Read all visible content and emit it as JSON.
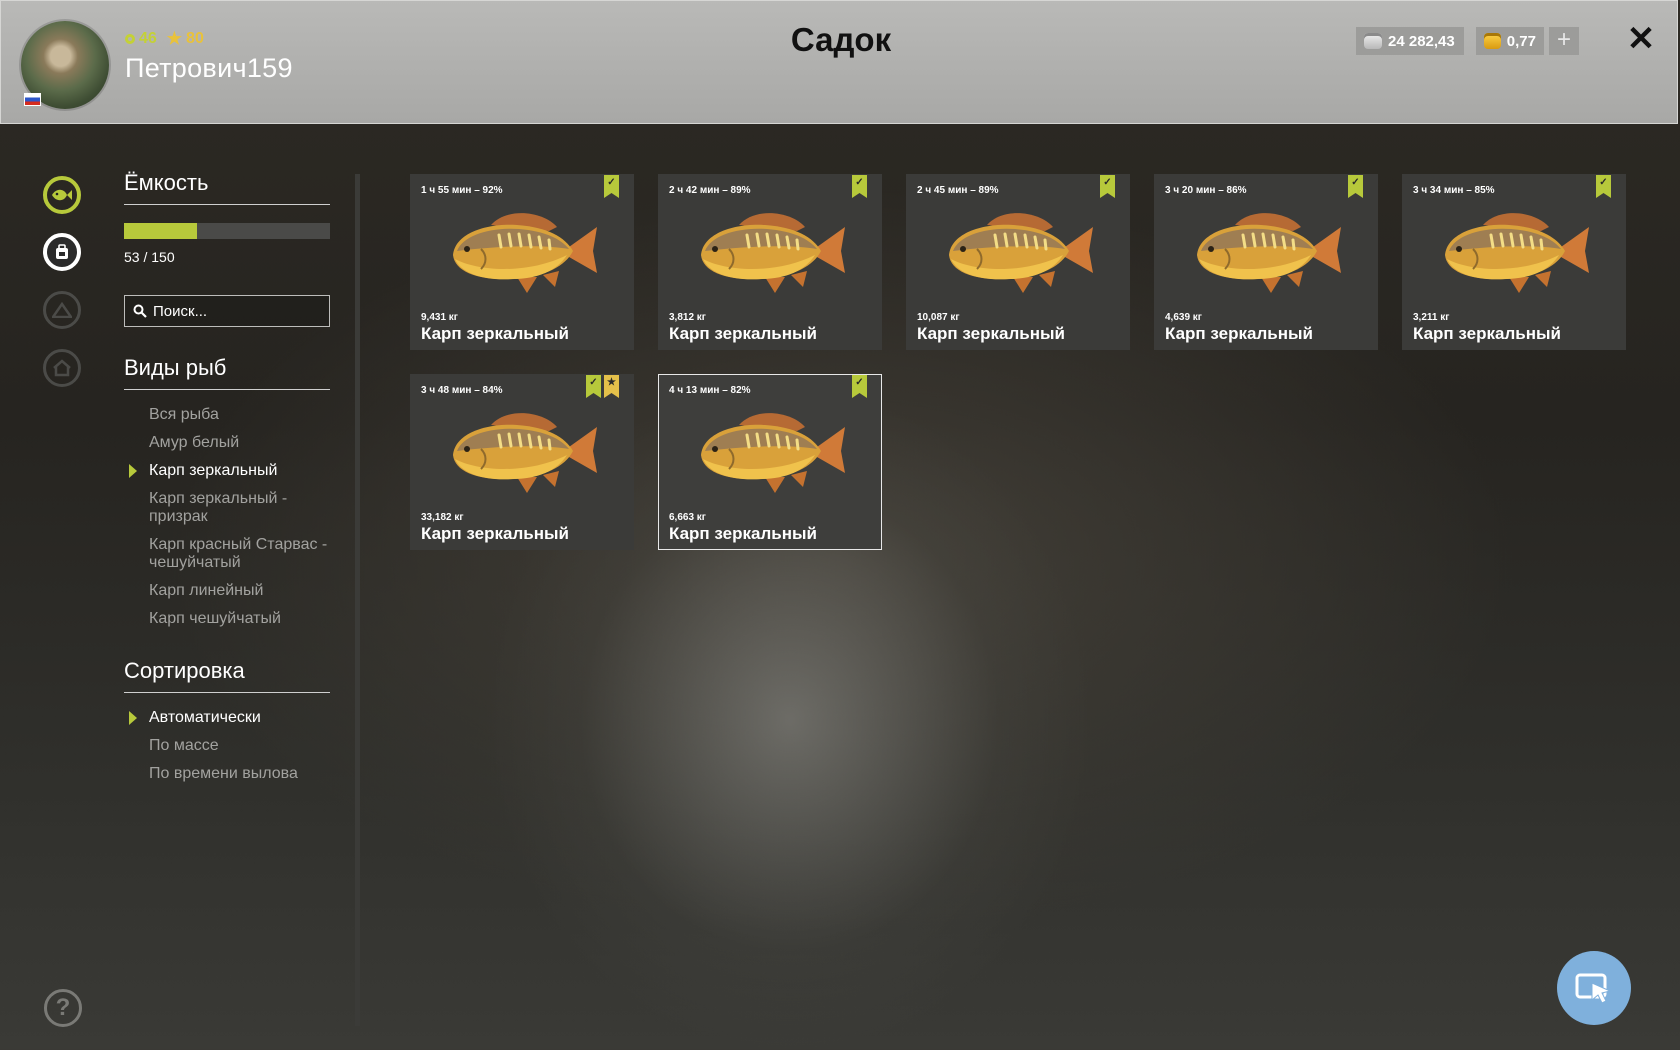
{
  "header": {
    "title": "Садок",
    "player": {
      "name": "Петрович159",
      "level": "46",
      "rank": "80"
    },
    "currency": {
      "silver": "24 282,43",
      "gold": "0,77",
      "add_label": "+"
    },
    "close_label": "✕"
  },
  "sidebar": {
    "capacity": {
      "title": "Ёмкость",
      "text": "53 / 150",
      "used": 53,
      "total": 150
    },
    "search": {
      "placeholder": "Поиск..."
    },
    "species": {
      "title": "Виды рыб",
      "items": [
        {
          "label": "Вся рыба",
          "active": false
        },
        {
          "label": "Амур белый",
          "active": false
        },
        {
          "label": "Карп зеркальный",
          "active": true
        },
        {
          "label": "Карп зеркальный - призрак",
          "active": false
        },
        {
          "label": "Карп красный Старвас - чешуйчатый",
          "active": false
        },
        {
          "label": "Карп линейный",
          "active": false
        },
        {
          "label": "Карп чешуйчатый",
          "active": false
        }
      ]
    },
    "sort": {
      "title": "Сортировка",
      "items": [
        {
          "label": "Автоматически",
          "active": true
        },
        {
          "label": "По массе",
          "active": false
        },
        {
          "label": "По времени вылова",
          "active": false
        }
      ]
    },
    "help_label": "?"
  },
  "fish": [
    {
      "time": "1 ч 55 мин – 92%",
      "weight": "9,431 кг",
      "name": "Карп зеркальный",
      "badges": [
        "check"
      ],
      "selected": false
    },
    {
      "time": "2 ч 42 мин – 89%",
      "weight": "3,812 кг",
      "name": "Карп зеркальный",
      "badges": [
        "check"
      ],
      "selected": false
    },
    {
      "time": "2 ч 45 мин – 89%",
      "weight": "10,087 кг",
      "name": "Карп зеркальный",
      "badges": [
        "check"
      ],
      "selected": false
    },
    {
      "time": "3 ч 20 мин – 86%",
      "weight": "4,639 кг",
      "name": "Карп зеркальный",
      "badges": [
        "check"
      ],
      "selected": false
    },
    {
      "time": "3 ч 34 мин – 85%",
      "weight": "3,211 кг",
      "name": "Карп зеркальный",
      "badges": [
        "check"
      ],
      "selected": false
    },
    {
      "time": "3 ч 48 мин – 84%",
      "weight": "33,182 кг",
      "name": "Карп зеркальный",
      "badges": [
        "check",
        "star"
      ],
      "selected": false
    },
    {
      "time": "4 ч 13 мин – 82%",
      "weight": "6,663 кг",
      "name": "Карп зеркальный",
      "badges": [
        "check"
      ],
      "selected": true
    }
  ],
  "colors": {
    "accent": "#b7c93b",
    "trophy": "#e4c04a",
    "card": "#3b3b39",
    "header": "#b1b1af",
    "cursor_button": "#7fb0dc"
  },
  "icons": [
    "ring-icon",
    "star-icon",
    "silver-coin-icon",
    "gold-coin-icon",
    "plus-icon",
    "close-icon",
    "fish-tab-icon",
    "bag-tab-icon",
    "tent-tab-icon",
    "home-tab-icon",
    "search-icon",
    "help-icon",
    "check-bookmark-icon",
    "star-bookmark-icon",
    "cursor-icon"
  ]
}
